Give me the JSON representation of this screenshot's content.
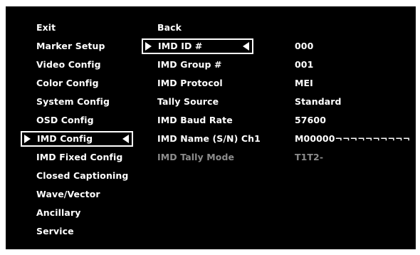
{
  "left_menu": {
    "items": [
      {
        "label": "Exit"
      },
      {
        "label": "Marker Setup"
      },
      {
        "label": "Video Config"
      },
      {
        "label": "Color Config"
      },
      {
        "label": "System Config"
      },
      {
        "label": "OSD Config"
      },
      {
        "label": "IMD Config",
        "selected": true
      },
      {
        "label": "IMD Fixed Config"
      },
      {
        "label": "Closed Captioning"
      },
      {
        "label": "Wave/Vector"
      },
      {
        "label": "Ancillary"
      },
      {
        "label": "Service"
      }
    ]
  },
  "sub_menu": {
    "items": [
      {
        "label": "Back"
      },
      {
        "label": "IMD ID #",
        "selected": true
      },
      {
        "label": "IMD Group #"
      },
      {
        "label": "IMD Protocol"
      },
      {
        "label": "Tally Source"
      },
      {
        "label": "IMD Baud Rate"
      },
      {
        "label": "IMD Name (S/N) Ch1"
      },
      {
        "label": "IMD Tally Mode",
        "disabled": true
      }
    ]
  },
  "values": {
    "items": [
      {
        "value": ""
      },
      {
        "value": "000"
      },
      {
        "value": "001"
      },
      {
        "value": "MEI"
      },
      {
        "value": "Standard"
      },
      {
        "value": "57600"
      },
      {
        "value": "M00000¬¬¬¬¬¬¬¬¬¬"
      },
      {
        "value": "T1T2-",
        "disabled": true
      }
    ]
  },
  "colors": {
    "background": "#000000",
    "text": "#ffffff",
    "disabled_text": "#8c8c8c"
  }
}
